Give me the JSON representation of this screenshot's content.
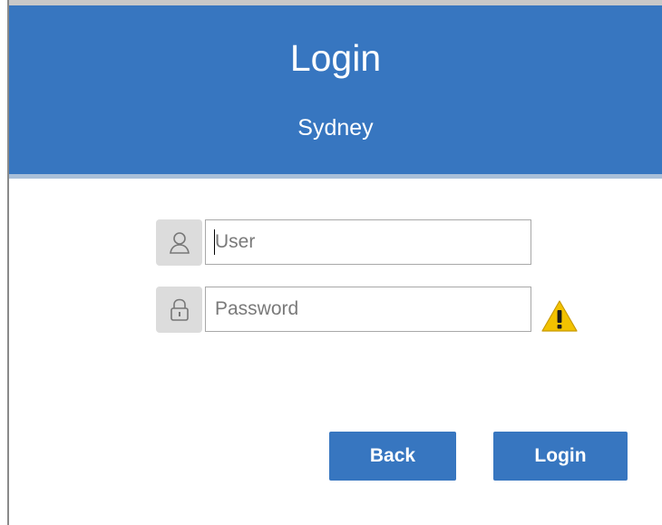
{
  "header": {
    "title": "Login",
    "subtitle": "Sydney"
  },
  "form": {
    "user": {
      "placeholder": "User",
      "value": "",
      "icon": "user-icon"
    },
    "password": {
      "placeholder": "Password",
      "value": "",
      "icon": "lock-icon",
      "status_icon": "warning-icon"
    }
  },
  "actions": {
    "back_label": "Back",
    "login_label": "Login"
  },
  "colors": {
    "accent": "#3776c0",
    "header_underline": "#a9bfd8",
    "icon_box": "#dcdcdc",
    "warning": "#f2c200"
  }
}
